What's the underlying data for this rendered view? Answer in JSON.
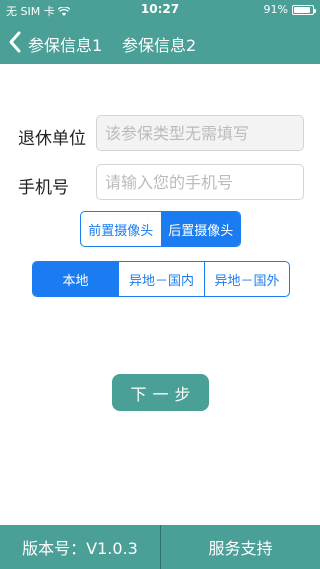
{
  "status_bar": {
    "carrier": "无 SIM 卡",
    "time": "10:27",
    "battery": "91%",
    "battery_level": 0.91
  },
  "nav": {
    "tabs": [
      "参保信息1",
      "参保信息2"
    ]
  },
  "form": {
    "retire_unit": {
      "label": "退休单位",
      "placeholder": "该参保类型无需填写"
    },
    "phone": {
      "label": "手机号",
      "placeholder": "请输入您的手机号"
    }
  },
  "camera_segment": {
    "options": [
      "前置摄像头",
      "后置摄像头"
    ],
    "selected": "后置摄像头"
  },
  "location_segment": {
    "options": [
      "本地",
      "异地－国内",
      "异地－国外"
    ],
    "selected": "本地"
  },
  "next_button": {
    "label": "下一步"
  },
  "footer": {
    "version": "版本号：V1.0.3",
    "support": "服务支持"
  },
  "colors": {
    "theme": "#4a9f96",
    "accent": "#1a7cf0"
  }
}
